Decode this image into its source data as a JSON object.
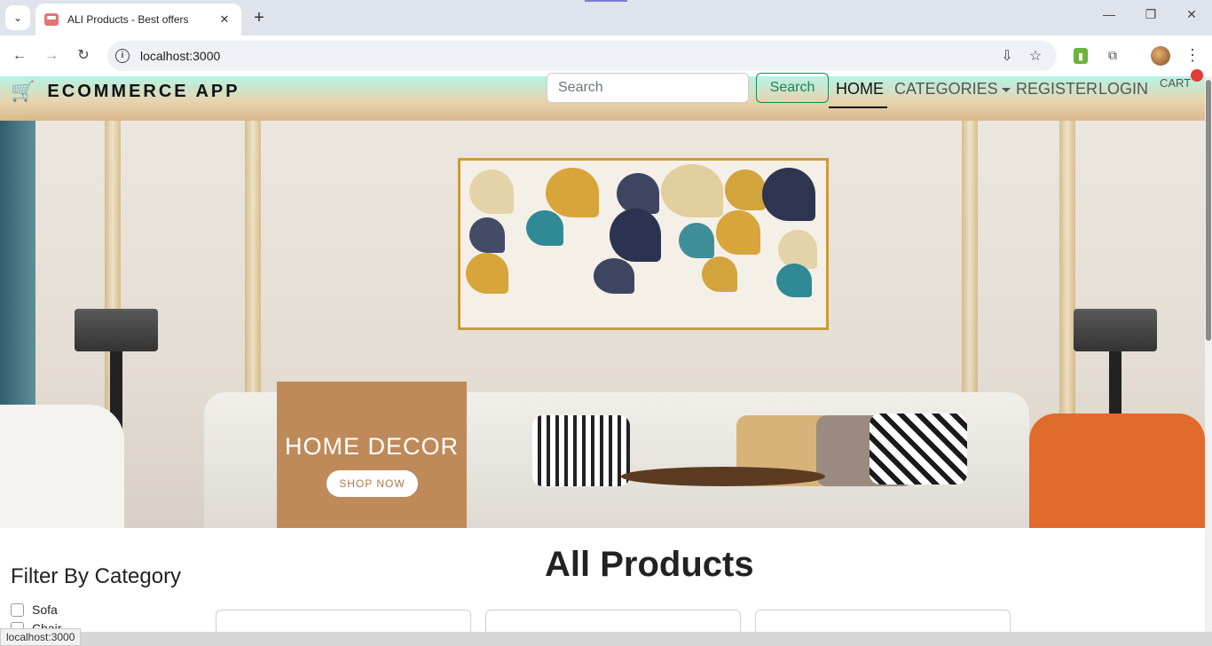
{
  "browser": {
    "tab_title": "ALI Products - Best offers",
    "url": "localhost:3000",
    "status_url": "localhost:3000"
  },
  "header": {
    "brand": "ECOMMERCE APP",
    "search_placeholder": "Search",
    "search_button": "Search",
    "nav": {
      "home": "HOME",
      "categories": "CATEGORIES",
      "register": "REGISTER",
      "login": "LOGIN",
      "cart": "CART"
    }
  },
  "hero": {
    "promo_title": "HOME DECOR",
    "promo_button": "SHOP NOW"
  },
  "filters": {
    "title": "Filter By Category",
    "categories": [
      "Sofa",
      "Chair"
    ]
  },
  "products": {
    "title": "All Products"
  },
  "colors": {
    "accent_green": "#198754",
    "promo_tan": "#bf8a5a",
    "header_gradient_top": "#b6f3e6",
    "header_gradient_bottom": "#dbb88a"
  }
}
